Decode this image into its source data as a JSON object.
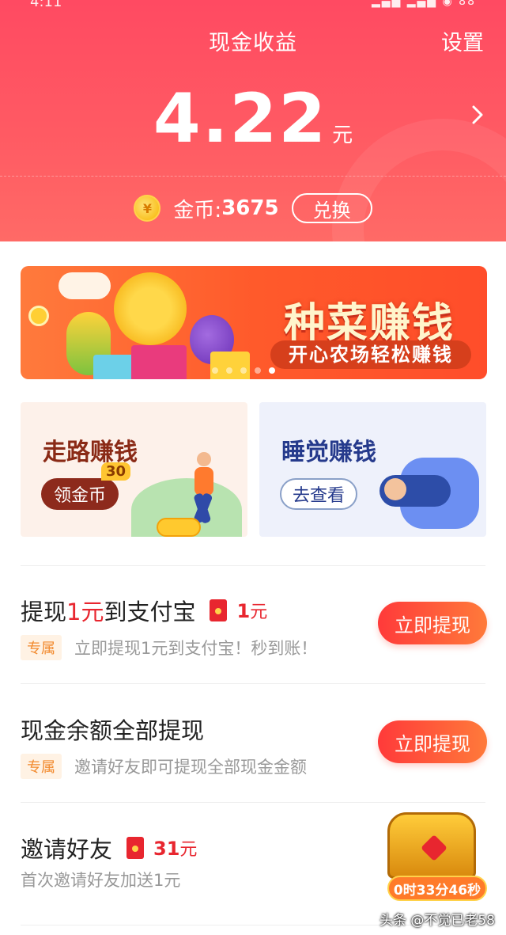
{
  "status_bar": {
    "time": "4:11",
    "battery": "88"
  },
  "header": {
    "title": "现金收益",
    "settings_label": "设置",
    "amount": "4.22",
    "amount_unit": "元",
    "coin_label": "金币:",
    "coin_value": "3675",
    "exchange_label": "兑换"
  },
  "banner": {
    "title": "种菜赚钱",
    "subtitle": "开心农场轻松赚钱",
    "slide_count": 5,
    "active_slide": 5
  },
  "cards": {
    "walk": {
      "title": "走路赚钱",
      "button_label": "领金币",
      "badge": "30"
    },
    "sleep": {
      "title": "睡觉赚钱",
      "button_label": "去查看"
    }
  },
  "tasks": [
    {
      "title_prefix": "提现",
      "title_highlight": "1元",
      "title_suffix": "到支付宝",
      "reward_value": "1",
      "reward_unit": "元",
      "tag": "专属",
      "subtitle": "立即提现1元到支付宝！秒到账！",
      "button_label": "立即提现"
    },
    {
      "title": "现金余额全部提现",
      "tag": "专属",
      "subtitle": "邀请好友即可提现全部现金金额",
      "button_label": "立即提现"
    },
    {
      "title": "邀请好友",
      "reward_value": "31",
      "reward_unit": "元",
      "subtitle": "首次邀请好友加送1元",
      "timer": "0时33分46秒"
    }
  ],
  "watermark": "头条 @不觉已老58",
  "colors": {
    "header": "#ff5563",
    "accent_red": "#e8262f",
    "button_gradient_start": "#ff3a3a",
    "button_gradient_end": "#ff7a3a"
  }
}
